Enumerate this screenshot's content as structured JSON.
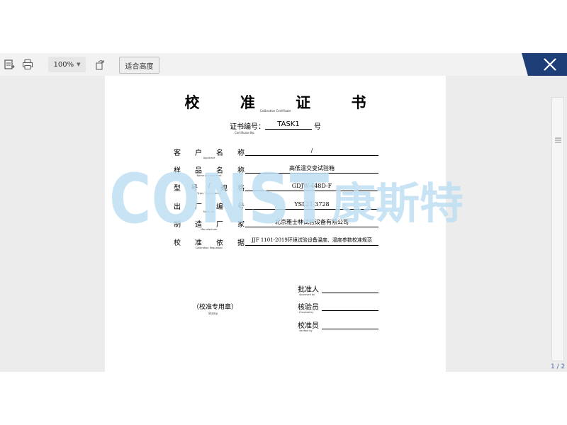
{
  "toolbar": {
    "zoom": "100%",
    "fit_height_label": "适合高度"
  },
  "pager": {
    "text": "1 / 2"
  },
  "certificate": {
    "title": "校 准 证 书",
    "title_en": "Calibration Certificate",
    "cert_no_label": "证书编号：",
    "cert_no_en": "Certificate No.",
    "cert_no_value": "TASK1",
    "cert_no_suffix": "号",
    "fields": [
      {
        "label": [
          "客",
          "户",
          "名",
          "称"
        ],
        "label_en": "Applicant",
        "value": "/"
      },
      {
        "label": [
          "样",
          "品",
          "名",
          "称"
        ],
        "label_en": "Name of instrument",
        "value": "高低温交变试验箱"
      },
      {
        "label": [
          "型",
          "号",
          "/",
          "规",
          "格"
        ],
        "label_en": "Type / Specification",
        "value": "GDJW-448D-F"
      },
      {
        "label": [
          "出",
          "厂",
          "编",
          "号"
        ],
        "label_en": "Serial No.",
        "value": "YSL21-3728"
      },
      {
        "label": [
          "制",
          "造",
          "厂",
          "家"
        ],
        "label_en": "Manufacturer",
        "value": "北京雅士林试验设备有限公司"
      },
      {
        "label": [
          "校",
          "准",
          "依",
          "据"
        ],
        "label_en": "Calibration Regulation",
        "value": "JJF 1101-2019环境试验设备温度、湿度参数校准规范"
      }
    ],
    "stamp_label": "（校准专用章）",
    "stamp_en": "Stamp",
    "signatures": [
      {
        "label": "批准人",
        "label_en": "Approved by"
      },
      {
        "label": "核验员",
        "label_en": "Checked by"
      },
      {
        "label": "校准员",
        "label_en": "Verified by"
      }
    ],
    "watermark": {
      "text": "CONST",
      "cn": "康斯特",
      "color": "#bfe0f3"
    }
  }
}
